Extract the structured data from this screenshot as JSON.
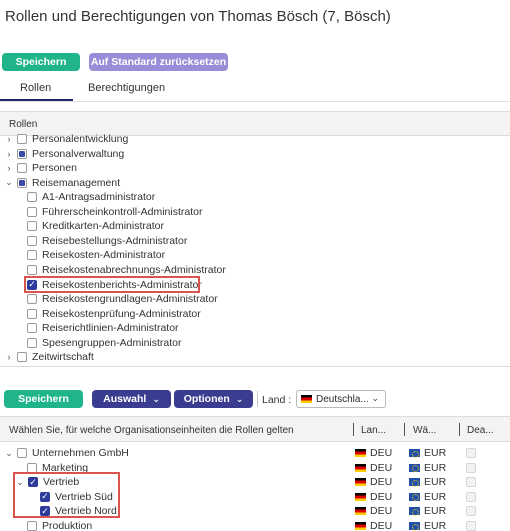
{
  "page_title": "Rollen und Berechtigungen von Thomas Bösch (7, Bösch)",
  "actions": {
    "save_label": "Speichern",
    "reset_label": "Auf Standard zurücksetzen"
  },
  "tabs": [
    {
      "label": "Rollen",
      "active": true
    },
    {
      "label": "Berechtigungen",
      "active": false
    }
  ],
  "roles_panel": {
    "header": "Rollen",
    "items": [
      {
        "label": "Personalentwicklung",
        "state": "unchecked",
        "expander": "collapsed",
        "level": 0
      },
      {
        "label": "Personalverwaltung",
        "state": "partial",
        "expander": "collapsed",
        "level": 0
      },
      {
        "label": "Personen",
        "state": "unchecked",
        "expander": "collapsed",
        "level": 0
      },
      {
        "label": "Reisemanagement",
        "state": "partial",
        "expander": "expanded",
        "level": 0
      },
      {
        "label": "A1-Antragsadministrator",
        "state": "unchecked",
        "level": 1
      },
      {
        "label": "Führerscheinkontroll-Administrator",
        "state": "unchecked",
        "level": 1
      },
      {
        "label": "Kreditkarten-Administrator",
        "state": "unchecked",
        "level": 1
      },
      {
        "label": "Reisebestellungs-Administrator",
        "state": "unchecked",
        "level": 1
      },
      {
        "label": "Reisekosten-Administrator",
        "state": "unchecked",
        "level": 1
      },
      {
        "label": "Reisekostenabrechnungs-Administrator",
        "state": "unchecked",
        "level": 1
      },
      {
        "label": "Reisekostenberichts-Administrator",
        "state": "checked",
        "level": 1,
        "highlighted": true
      },
      {
        "label": "Reisekostengrundlagen-Administrator",
        "state": "unchecked",
        "level": 1
      },
      {
        "label": "Reisekostenprüfung-Administrator",
        "state": "unchecked",
        "level": 1
      },
      {
        "label": "Reiserichtlinien-Administrator",
        "state": "unchecked",
        "level": 1
      },
      {
        "label": "Spesengruppen-Administrator",
        "state": "unchecked",
        "level": 1
      },
      {
        "label": "Zeitwirtschaft",
        "state": "unchecked",
        "expander": "collapsed",
        "level": 0
      }
    ]
  },
  "toolbar": {
    "save_label": "Speichern",
    "selection_label": "Auswahl",
    "options_label": "Optionen",
    "country_label": "Land :",
    "country_value": "Deutschla..."
  },
  "org_grid": {
    "columns": [
      "Wählen Sie, für welche Organisationseinheiten die Rollen gelten",
      "Lan...",
      "Wä...",
      "Dea..."
    ],
    "rows": [
      {
        "name": "Unternehmen GmbH",
        "state": "unchecked",
        "expander": "expanded",
        "level": 0,
        "country": "DEU",
        "currency": "EUR"
      },
      {
        "name": "Marketing",
        "state": "unchecked",
        "level": 1,
        "country": "DEU",
        "currency": "EUR"
      },
      {
        "name": "Vertrieb",
        "state": "checked",
        "expander": "expanded",
        "level": 1,
        "country": "DEU",
        "currency": "EUR"
      },
      {
        "name": "Vertrieb Süd",
        "state": "checked",
        "level": 2,
        "country": "DEU",
        "currency": "EUR"
      },
      {
        "name": "Vertrieb Nord",
        "state": "checked",
        "level": 2,
        "country": "DEU",
        "currency": "EUR"
      },
      {
        "name": "Produktion",
        "state": "unchecked",
        "level": 1,
        "country": "DEU",
        "currency": "EUR"
      }
    ]
  },
  "colors": {
    "green": "#1fb48a",
    "purple": "#9a8cd6",
    "navy": "#3a3d8f",
    "highlight": "#d9534f",
    "check": "#2f3b9c"
  }
}
